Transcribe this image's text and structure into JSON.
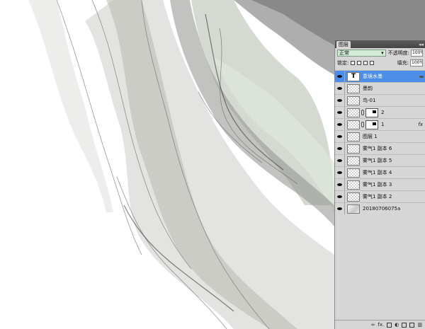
{
  "panel": {
    "tab_label": "图层",
    "collapse_glyph": "◂◂",
    "blend_mode": "正常",
    "opacity_label": "不透明度:",
    "opacity_value": "100%",
    "lock_label": "锁定:",
    "fill_label": "填充:",
    "fill_value": "100%"
  },
  "layers": [
    {
      "name": "意境水墨",
      "thumb": "text",
      "thumb_glyph": "T",
      "selected": true
    },
    {
      "name": "墨韵",
      "thumb": "checker"
    },
    {
      "name": "鸟-01",
      "thumb": "checker"
    },
    {
      "name": "2",
      "thumb": "checker",
      "mask": true
    },
    {
      "name": "1",
      "thumb": "checker",
      "mask": true,
      "fx": "fx"
    },
    {
      "name": "图层 1",
      "thumb": "checker"
    },
    {
      "name": "雾气1 副本 6",
      "thumb": "checker"
    },
    {
      "name": "雾气1 副本 5",
      "thumb": "checker"
    },
    {
      "name": "雾气1 副本 4",
      "thumb": "checker"
    },
    {
      "name": "雾气1 副本 3",
      "thumb": "checker"
    },
    {
      "name": "雾气1 副本 2",
      "thumb": "checker"
    },
    {
      "name": "20180706075a",
      "thumb": "photo"
    }
  ],
  "footer": {
    "fx_label": "fx."
  }
}
